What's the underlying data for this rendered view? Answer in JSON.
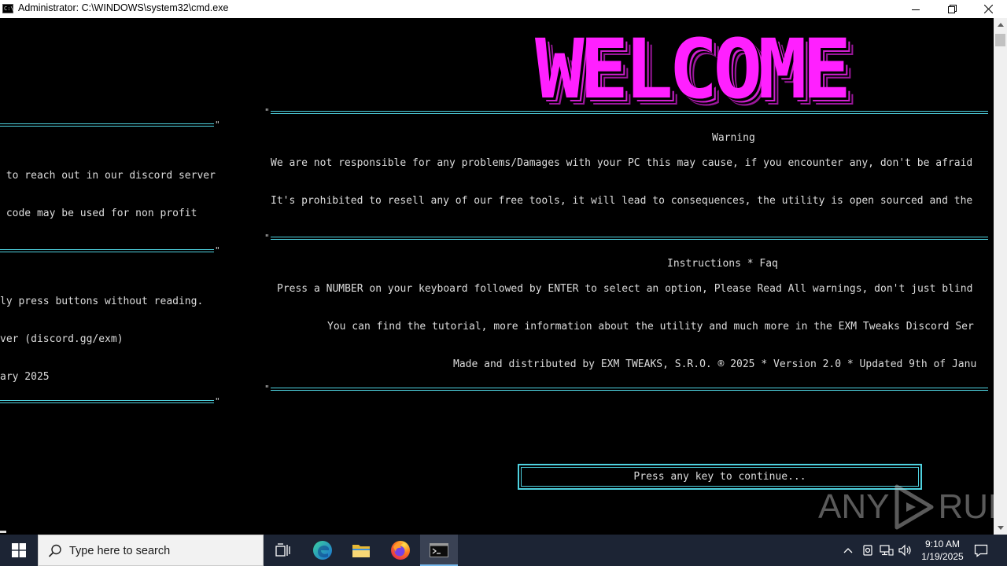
{
  "window": {
    "title": "Administrator: C:\\WINDOWS\\system32\\cmd.exe",
    "app_icon_text": "C:\\"
  },
  "console": {
    "banner": "WELCOME",
    "left_lines": [
      " to reach out in our discord server",
      " code may be used for non profit",
      "ly press buttons without reading.",
      "ver (discord.gg/exm)",
      "ary 2025"
    ],
    "warning_title": "Warning",
    "warning_lines": [
      "We are not responsible for any problems/Damages with your PC this may cause, if you encounter any, don't be afraid",
      "It's prohibited to resell any of our free tools, it will lead to consequences, the utility is open sourced and the"
    ],
    "instructions_title": "Instructions * Faq",
    "instructions_lines": [
      "Press a NUMBER on your keyboard followed by ENTER to select an option, Please Read All warnings, don't just blind",
      "You can find the tutorial, more information about the utility and much more in the EXM Tweaks Discord Ser",
      "Made and distributed by EXM TWEAKS, S.R.O. ® 2025 * Version 2.0 * Updated 9th of Janu"
    ],
    "prompt": "Press any key to continue...",
    "line_color": "#4fd2e0",
    "banner_color": "#ff20ff"
  },
  "watermark": {
    "left": "ANY",
    "right": "RUN"
  },
  "taskbar": {
    "search_placeholder": "Type here to search",
    "apps": [
      "start-button",
      "task-view-icon",
      "edge-icon",
      "file-explorer-icon",
      "firefox-icon",
      "cmd-icon"
    ],
    "time": "9:10 AM",
    "date": "1/19/2025"
  }
}
